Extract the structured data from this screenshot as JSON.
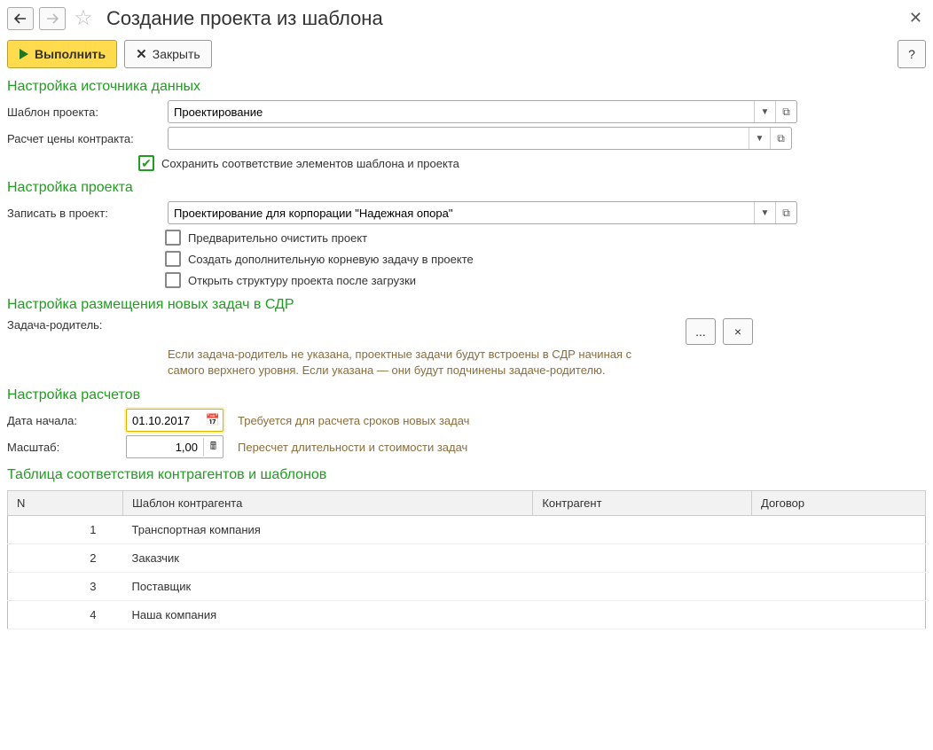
{
  "header": {
    "title": "Создание проекта из шаблона"
  },
  "cmdbar": {
    "execute": "Выполнить",
    "close": "Закрыть",
    "help": "?"
  },
  "sec_source": {
    "head": "Настройка источника данных",
    "template_label": "Шаблон проекта:",
    "template_value": "Проектирование",
    "calc_label": "Расчет цены контракта:",
    "calc_value": "",
    "chk_save": "Сохранить соответствие элементов шаблона и проекта"
  },
  "sec_project": {
    "head": "Настройка проекта",
    "writeto_label": "Записать в проект:",
    "writeto_value": "Проектирование для корпорации \"Надежная опора\"",
    "chk_clear": "Предварительно очистить проект",
    "chk_root": "Создать дополнительную корневую задачу в проекте",
    "chk_open": "Открыть структуру проекта после загрузки"
  },
  "sec_wbs": {
    "head": "Настройка размещения новых задач в СДР",
    "parent_label": "Задача-родитель:",
    "dots": "...",
    "clear": "×",
    "hint": "Если задача-родитель не указана, проектные задачи будут встроены в СДР начиная с самого верхнего уровня. Если указана — они будут подчинены задаче-родителю."
  },
  "sec_calc": {
    "head": "Настройка расчетов",
    "date_label": "Дата начала:",
    "date_value": "01.10.2017",
    "date_hint": "Требуется для расчета сроков новых задач",
    "scale_label": "Масштаб:",
    "scale_value": "1,00",
    "scale_hint": "Пересчет длительности и стоимости задач"
  },
  "sec_table": {
    "head": "Таблица соответствия контрагентов и шаблонов",
    "cols": {
      "n": "N",
      "tpl": "Шаблон контрагента",
      "ctr": "Контрагент",
      "dog": "Договор"
    },
    "rows": [
      {
        "n": "1",
        "tpl": "Транспортная компания"
      },
      {
        "n": "2",
        "tpl": "Заказчик"
      },
      {
        "n": "3",
        "tpl": "Поставщик"
      },
      {
        "n": "4",
        "tpl": "Наша компания"
      }
    ]
  }
}
